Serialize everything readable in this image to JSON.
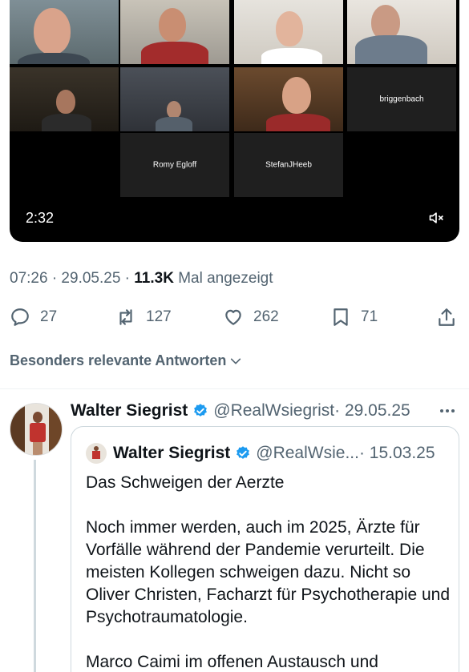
{
  "video": {
    "participants": [
      {
        "name": ""
      },
      {
        "name": ""
      },
      {
        "name": ""
      },
      {
        "name": ""
      },
      {
        "name": ""
      },
      {
        "name": ""
      },
      {
        "name": ""
      },
      {
        "name": "briggenbach"
      },
      {
        "name": "Romy Egloff"
      },
      {
        "name": "StefanJHeeb"
      }
    ],
    "time": "2:32",
    "mute_icon": "speaker-muted-icon"
  },
  "meta": {
    "timestamp": "07:26 · 29.05.25 · ",
    "views": "11.3K",
    "views_suffix": " Mal angezeigt"
  },
  "actions": {
    "reply_count": "27",
    "repost_count": "127",
    "like_count": "262",
    "bookmark_count": "71",
    "icons": [
      "reply-icon",
      "repost-icon",
      "like-icon",
      "bookmark-icon",
      "share-icon"
    ]
  },
  "sort": {
    "label": "Besonders relevante Antworten"
  },
  "reply": {
    "name": "Walter Siegrist",
    "handle": "@RealWsiegrist",
    "date": "· 29.05.25"
  },
  "quote": {
    "name": "Walter Siegrist",
    "handle": "@RealWsie...",
    "date": "· 15.03.25",
    "paragraphs": [
      "Das Schweigen der Aerzte",
      "Noch immer werden, auch im 2025, Ärzte für Vorfälle während der Pandemie verurteilt. Die meisten Kollegen schweigen dazu. Nicht so Oliver Christen, Facharzt für Psychotherapie und Psychotraumatologie.",
      "Marco Caimi im offenen Austausch und"
    ]
  },
  "colors": {
    "text": "#0f1419",
    "secondary": "#536471",
    "verified": "#1d9bf0",
    "border": "#cfd9de"
  }
}
